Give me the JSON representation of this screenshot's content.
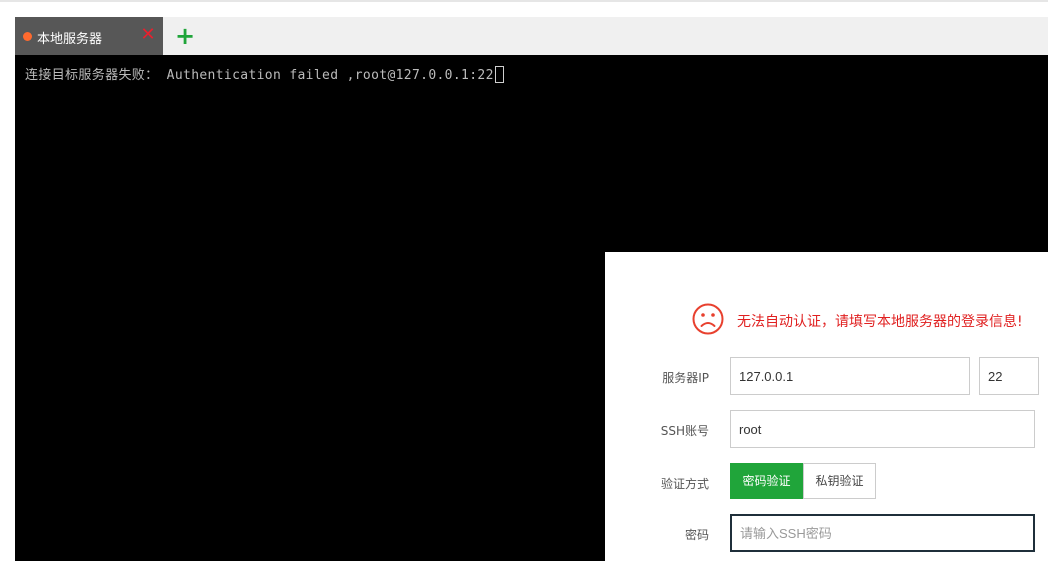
{
  "tabs": [
    {
      "label": "本地服务器",
      "active": true
    }
  ],
  "tab_close_glyph": "✕",
  "tab_add_glyph": "+",
  "terminal": {
    "line": "连接目标服务器失败： Authentication failed ,root@127.0.0.1:22"
  },
  "dialog": {
    "icon": "sad-face-icon",
    "error_message": "无法自动认证，请填写本地服务器的登录信息!",
    "server_ip_label": "服务器IP",
    "server_ip_value": "127.0.0.1",
    "port_value": "22",
    "ssh_account_label": "SSH账号",
    "ssh_account_value": "root",
    "auth_method_label": "验证方式",
    "auth_options": [
      "密码验证",
      "私钥验证"
    ],
    "auth_selected": "密码验证",
    "password_label": "密码",
    "password_placeholder": "请输入SSH密码"
  },
  "colors": {
    "accent_green": "#20a53a",
    "error_red": "#e02020",
    "tab_dot": "#ff6a2e",
    "terminal_bg": "#000000"
  }
}
